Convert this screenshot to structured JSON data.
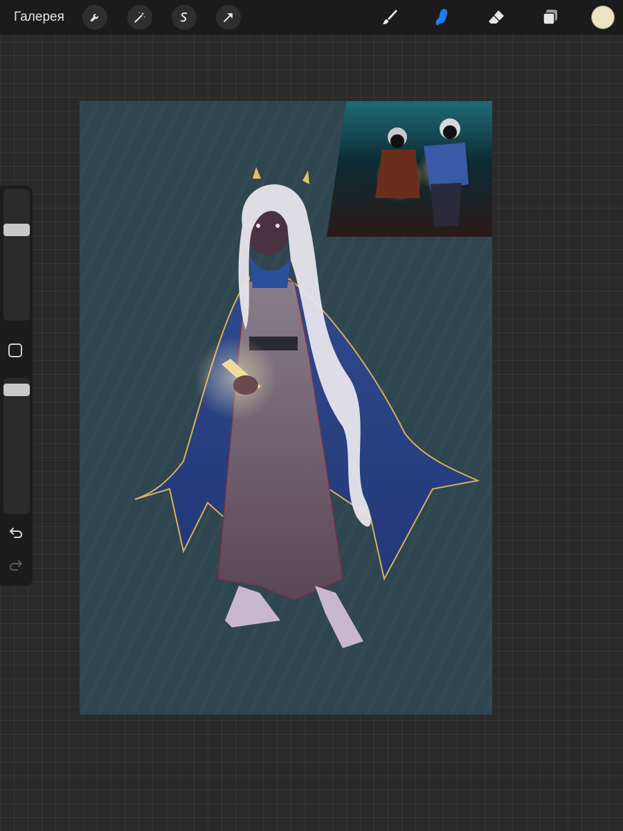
{
  "topbar": {
    "gallery_label": "Галерея",
    "tools_left": [
      {
        "name": "actions",
        "icon": "wrench-icon"
      },
      {
        "name": "adjustments",
        "icon": "magic-wand-icon"
      },
      {
        "name": "selection",
        "icon": "selection-s-icon"
      },
      {
        "name": "transform",
        "icon": "arrow-cursor-icon"
      }
    ],
    "tools_right": [
      {
        "name": "brush",
        "icon": "brush-icon",
        "active": false
      },
      {
        "name": "smudge",
        "icon": "smudge-finger-icon",
        "active": true
      },
      {
        "name": "eraser",
        "icon": "eraser-icon",
        "active": false
      },
      {
        "name": "layers",
        "icon": "layers-icon",
        "active": false
      }
    ],
    "active_color": "#eee3c2",
    "accent_color": "#1e7cf2"
  },
  "sidebar": {
    "brush_size_level": 0.12,
    "opacity_level": 0.02,
    "undo_icon": "undo-arrow-icon",
    "redo_icon": "redo-arrow-icon"
  },
  "canvas": {
    "background_color": "#2f4550",
    "artwork": "character-illustration",
    "reference_image": "reference-photo"
  }
}
